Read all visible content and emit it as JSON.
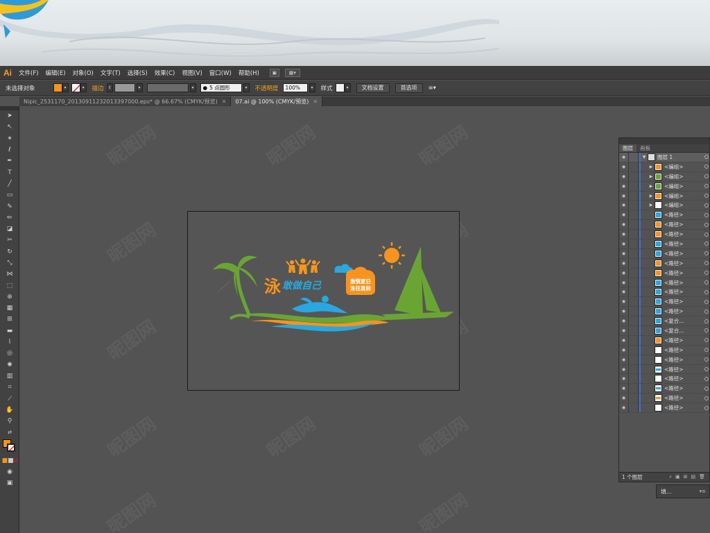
{
  "app": {
    "logo": "Ai",
    "menu": [
      "文件(F)",
      "编辑(E)",
      "对象(O)",
      "文字(T)",
      "选择(S)",
      "效果(C)",
      "视图(V)",
      "窗口(W)",
      "帮助(H)"
    ]
  },
  "control_bar": {
    "selection_status": "未选择对象",
    "fill_color": "#f7941d",
    "stroke_label": "描边",
    "brush_value": "5 点圆形",
    "opacity_label": "不透明度",
    "opacity_value": "100%",
    "style_label": "样式",
    "doc_setup_button": "文档设置",
    "preferences_button": "首选项"
  },
  "tabs": [
    {
      "label": "Nipic_2531170_20130911232013397000.eps* @ 66.67% (CMYK/预览)",
      "active": false
    },
    {
      "label": "07.ai @ 100% (CMYK/预览)",
      "active": true
    }
  ],
  "artwork": {
    "title_char": "泳",
    "title_rest": "敢做自己",
    "badge_line1": "激情夏日",
    "badge_line2": "泳往直前",
    "colors": {
      "green": "#6aa534",
      "blue": "#2aa7e0",
      "orange": "#f7941d"
    }
  },
  "layers_panel": {
    "tabs": [
      "图层",
      "画板"
    ],
    "top_layer": "图层 1",
    "items": [
      "<编组>",
      "<编组>",
      "<编组>",
      "<编组>",
      "<编组>",
      "<路径>",
      "<路径>",
      "<路径>",
      "<路径>",
      "<路径>",
      "<路径>",
      "<路径>",
      "<路径>",
      "<路径>",
      "<路径>",
      "<路径>",
      "<复合...",
      "<复合...",
      "<路径>",
      "<路径>",
      "<路径>",
      "<路径>",
      "<路径>",
      "<路径>",
      "<路径>",
      "<路径>"
    ],
    "footer": "1 个图层"
  },
  "mini_panel": {
    "label": "填..."
  },
  "watermark": "昵图网"
}
